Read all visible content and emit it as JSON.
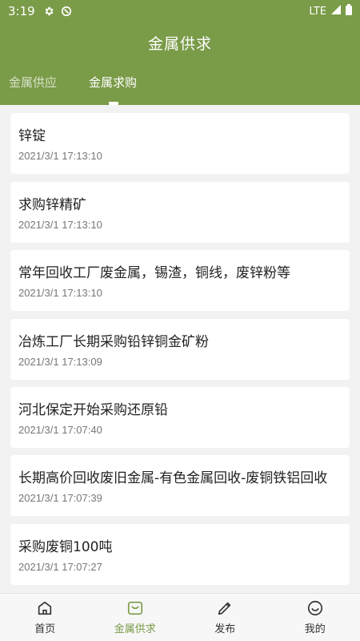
{
  "status": {
    "time": "3:19",
    "network": "LTE"
  },
  "header": {
    "title": "金属供求"
  },
  "tabs": [
    {
      "label": "金属供应"
    },
    {
      "label": "金属求购"
    }
  ],
  "items": [
    {
      "title": "锌锭",
      "time": "2021/3/1 17:13:10"
    },
    {
      "title": "求购锌精矿",
      "time": "2021/3/1 17:13:10"
    },
    {
      "title": "常年回收工厂废金属，锡渣，铜线，废锌粉等",
      "time": "2021/3/1 17:13:10"
    },
    {
      "title": "冶炼工厂长期采购铅锌铜金矿粉",
      "time": "2021/3/1 17:13:09"
    },
    {
      "title": "河北保定开始采购还原铅",
      "time": "2021/3/1 17:07:40"
    },
    {
      "title": "长期高价回收废旧金属-有色金属回收-废铜铁铝回收",
      "time": "2021/3/1 17:07:39"
    },
    {
      "title": "采购废铜100吨",
      "time": "2021/3/1 17:07:27"
    }
  ],
  "nav": [
    {
      "label": "首页",
      "icon": "home-icon"
    },
    {
      "label": "金属供求",
      "icon": "bag-icon"
    },
    {
      "label": "发布",
      "icon": "pencil-icon"
    },
    {
      "label": "我的",
      "icon": "smile-icon"
    }
  ],
  "colors": {
    "primary": "#7a9b48"
  }
}
